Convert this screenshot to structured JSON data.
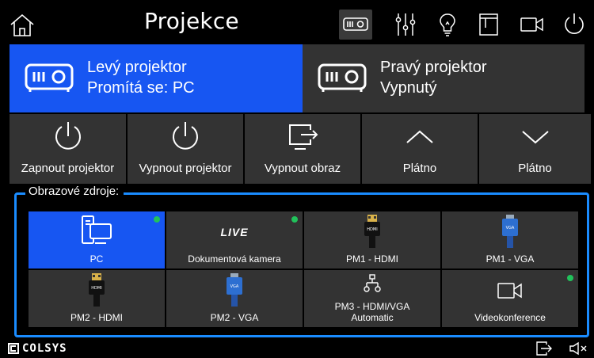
{
  "header": {
    "title": "Projekce",
    "icons": [
      "home-icon",
      "projector-icon",
      "mixer-icon",
      "bulb-icon",
      "screen-icon",
      "camera-icon",
      "power-icon"
    ]
  },
  "projectors": [
    {
      "name": "Levý projektor",
      "status": "Promítá se: PC",
      "selected": true
    },
    {
      "name": "Pravý projektor",
      "status": "Vypnutý",
      "selected": false
    }
  ],
  "actions": [
    {
      "label": "Zapnout projektor",
      "icon": "power-icon"
    },
    {
      "label": "Vypnout projektor",
      "icon": "power-icon"
    },
    {
      "label": "Vypnout obraz",
      "icon": "screen-off-icon"
    },
    {
      "label": "Plátno",
      "icon": "chevron-up-icon"
    },
    {
      "label": "Plátno",
      "icon": "chevron-down-icon"
    }
  ],
  "sources": {
    "label": "Obrazové zdroje:",
    "items": [
      {
        "label": "PC",
        "icon": "pc-icon",
        "active": true,
        "signal": true
      },
      {
        "label": "Dokumentová kamera",
        "icon_text": "LIVE",
        "active": false,
        "signal": true
      },
      {
        "label": "PM1 - HDMI",
        "icon": "hdmi-icon",
        "active": false,
        "signal": false
      },
      {
        "label": "PM1 - VGA",
        "icon": "vga-icon",
        "active": false,
        "signal": false
      },
      {
        "label": "PM2 - HDMI",
        "icon": "hdmi-icon",
        "active": false,
        "signal": false
      },
      {
        "label": "PM2 - VGA",
        "icon": "vga-icon",
        "active": false,
        "signal": false
      },
      {
        "label": "PM3 - HDMI/VGA",
        "label2": "Automatic",
        "icon": "network-icon",
        "active": false,
        "signal": false
      },
      {
        "label": "Videokonference",
        "icon": "camera-icon",
        "active": false,
        "signal": true
      }
    ]
  },
  "footer": {
    "logo": "COLSYS",
    "icons": [
      "exit-icon",
      "mute-icon"
    ]
  },
  "colors": {
    "accent": "#1756f2",
    "frame": "#1a8cff",
    "tile": "#333333",
    "signal": "#21c25b"
  }
}
